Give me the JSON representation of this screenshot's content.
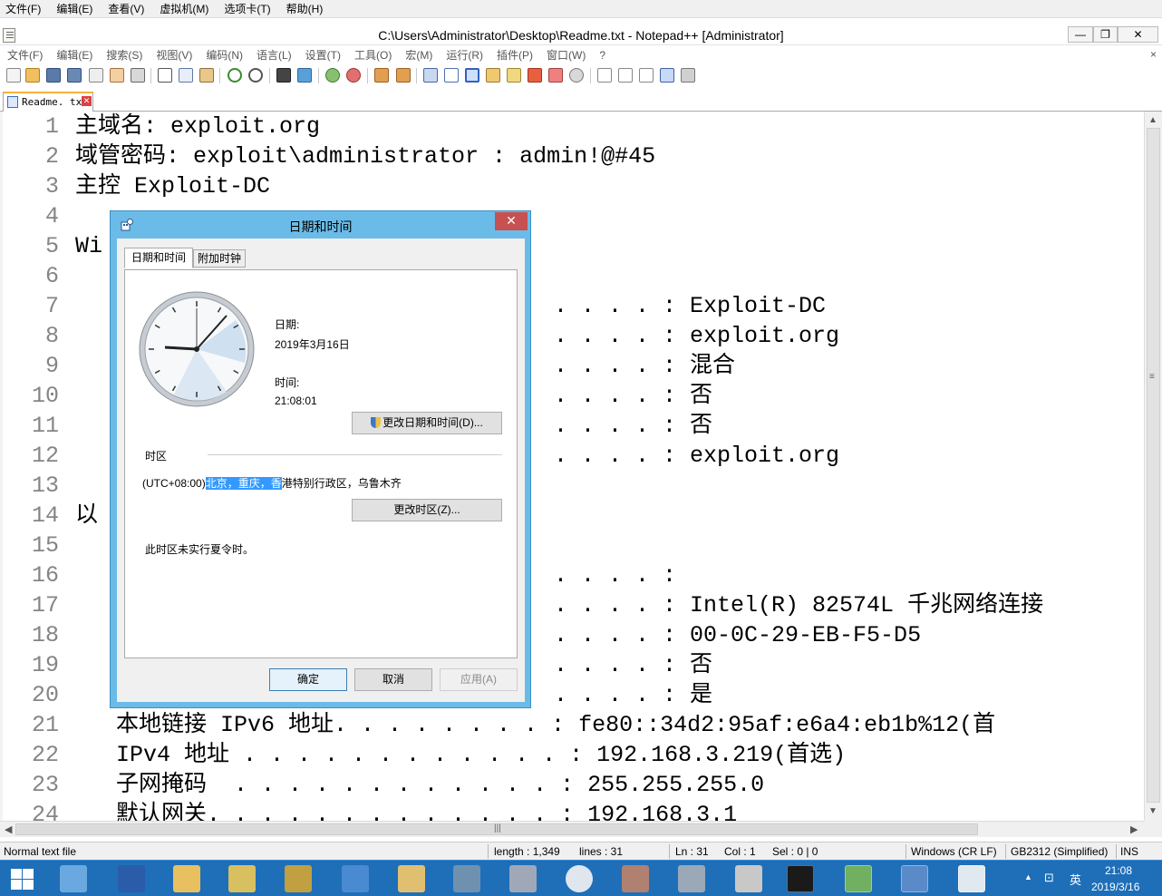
{
  "vm_menu": [
    "文件(F)",
    "编辑(E)",
    "查看(V)",
    "虚拟机(M)",
    "选项卡(T)",
    "帮助(H)"
  ],
  "window": {
    "title": "C:\\Users\\Administrator\\Desktop\\Readme.txt - Notepad++ [Administrator]",
    "minimize": "—",
    "maximize": "❐",
    "close": "✕"
  },
  "npp_menu": [
    "文件(F)",
    "编辑(E)",
    "搜索(S)",
    "视图(V)",
    "编码(N)",
    "语言(L)",
    "设置(T)",
    "工具(O)",
    "宏(M)",
    "运行(R)",
    "插件(P)",
    "窗口(W)",
    "?"
  ],
  "npp_menu_close": "×",
  "tab": {
    "label": "Readme. txt",
    "close": "✕"
  },
  "editor": {
    "line_numbers": [
      "1",
      "2",
      "3",
      "4",
      "5",
      "6",
      "7",
      "8",
      "9",
      "10",
      "11",
      "12",
      "13",
      "14",
      "15",
      "16",
      "17",
      "18",
      "19",
      "20",
      "21",
      "22",
      "23",
      "24"
    ],
    "lines": {
      "l1": "主域名: exploit.org",
      "l2": "域管密码: exploit\\administrator : admin!@#45",
      "l3": "主控 Exploit-DC",
      "l4": "",
      "l5": "Wi",
      "l7": ". . . . : Exploit-DC",
      "l8": ". . . . : exploit.org",
      "l9": ". . . . : 混合",
      "l10": ". . . . : 否",
      "l11": ". . . . : 否",
      "l12": ". . . . : exploit.org",
      "l14": "以",
      "l16": ". . . . :",
      "l17": ". . . . : Intel(R) 82574L 千兆网络连接",
      "l18": ". . . . : 00-0C-29-EB-F5-D5",
      "l19": ". . . . : 否",
      "l20": ". . . . : 是",
      "l21": "   本地链接 IPv6 地址. . . . . . . . : fe80::34d2:95af:e6a4:eb1b%12(首",
      "l22": "   IPv4 地址 . . . . . . . . . . . . : 192.168.3.219(首选)",
      "l23": "   子网掩码  . . . . . . . . . . . . : 255.255.255.0",
      "l24": "   默认网关. . . . . . . . . . . . . : 192.168.3.1"
    }
  },
  "status": {
    "filetype": "Normal text file",
    "length": "length : 1,349",
    "lines": "lines : 31",
    "ln": "Ln : 31",
    "col": "Col : 1",
    "sel": "Sel : 0 | 0",
    "eol": "Windows (CR LF)",
    "encoding": "GB2312 (Simplified)",
    "mode": "INS"
  },
  "dialog": {
    "title": "日期和时间",
    "close": "✕",
    "tabs": [
      "日期和时间",
      "附加时钟"
    ],
    "date_label": "日期:",
    "date_value": "2019年3月16日",
    "time_label": "时间:",
    "time_value": "21:08:01",
    "change_datetime_button": "更改日期和时间(D)...",
    "timezone_header": "时区",
    "timezone_prefix": "(UTC+08:00)",
    "timezone_selected": "北京，重庆，香",
    "timezone_rest": "港特别行政区，乌鲁木齐",
    "change_timezone_button": "更改时区(Z)...",
    "dst_note": "此时区未实行夏令时。",
    "ok_button": "确定",
    "cancel_button": "取消",
    "apply_button": "应用(A)"
  },
  "tray": {
    "ime": "英",
    "time": "21:08",
    "date": "2019/3/16"
  },
  "colors": {
    "dialog_frame": "#6bbbe8",
    "selection": "#3399ff",
    "taskbar": "#1e6fb8",
    "tab_accent": "#fab03a",
    "line_number": "#858585"
  }
}
